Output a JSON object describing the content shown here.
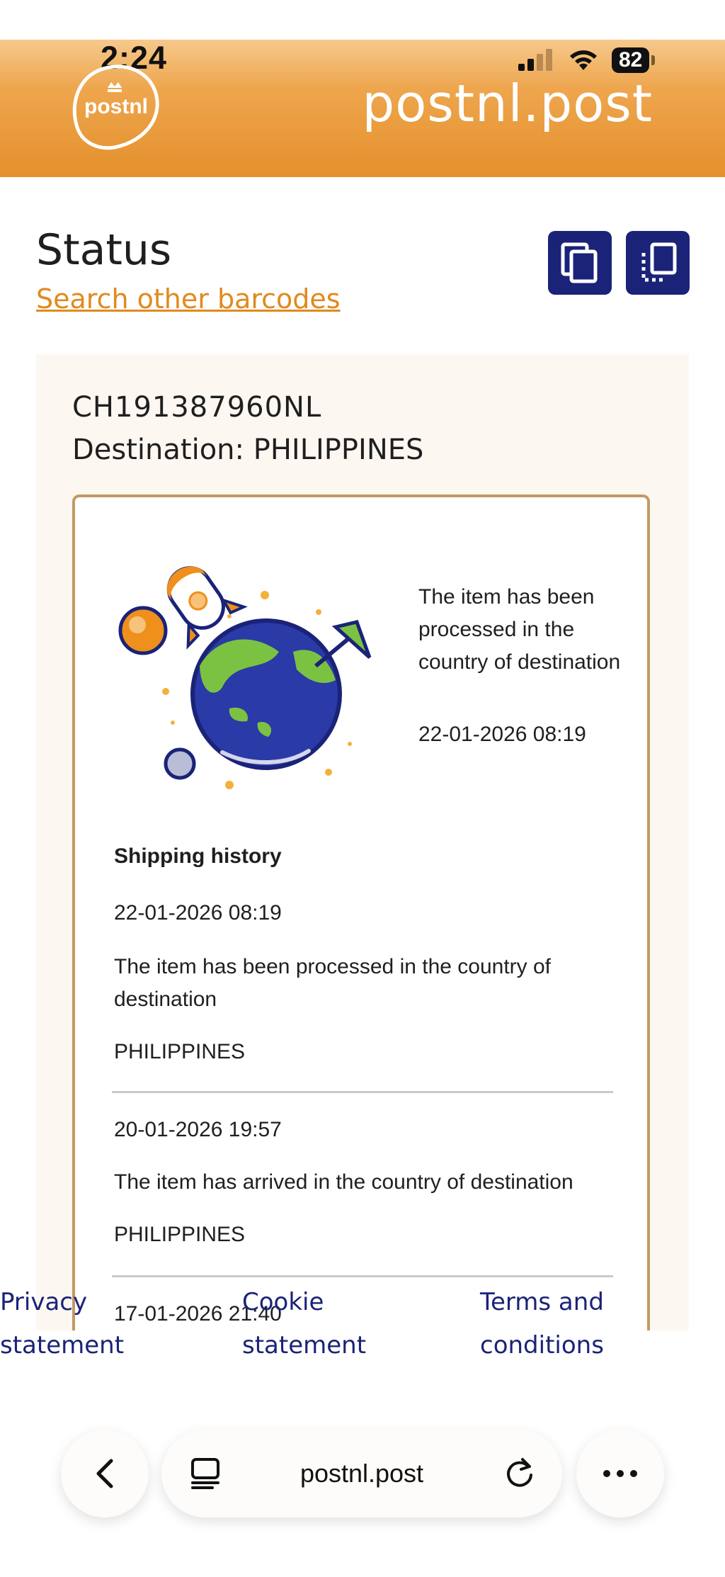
{
  "status_bar": {
    "time": "2:24",
    "battery": "82"
  },
  "header": {
    "logo_text": "postnl",
    "site_title": "postnl.post"
  },
  "page": {
    "title": "Status",
    "search_link": "Search other barcodes"
  },
  "shipment": {
    "barcode": "CH191387960NL",
    "destination": "Destination: PHILIPPINES",
    "current_status": "The item has been processed in the country of destination",
    "current_date": "22-01-2026 08:19"
  },
  "history": {
    "title": "Shipping history",
    "events": [
      {
        "date": "22-01-2026 08:19",
        "description": "The item has been processed in the country of destination",
        "location": "PHILIPPINES"
      },
      {
        "date": "20-01-2026 19:57",
        "description": "The item has arrived in the country of destination",
        "location": "PHILIPPINES"
      },
      {
        "date": "17-01-2026 21:40"
      }
    ]
  },
  "footer": {
    "privacy": "Privacy statement",
    "cookie": "Cookie statement",
    "terms": "Terms and conditions"
  },
  "browser": {
    "url": "postnl.post"
  },
  "colors": {
    "brand_orange": "#e4902c",
    "navy": "#1a2378",
    "panel_bg": "#fcf7f1",
    "card_border": "#c29a63"
  }
}
